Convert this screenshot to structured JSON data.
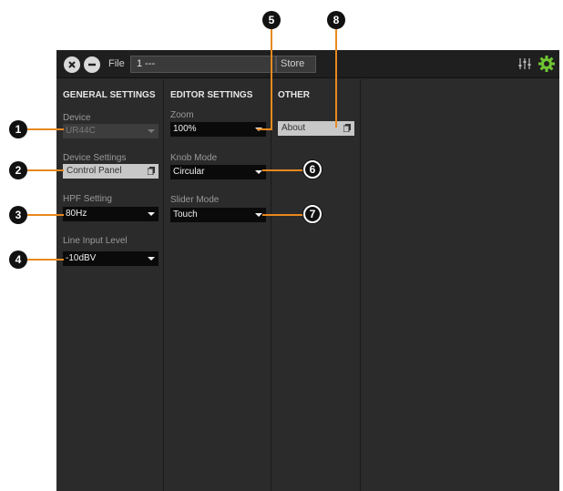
{
  "topbar": {
    "file_label": "File",
    "file_value": "1   ---",
    "store_label": "Store"
  },
  "general_settings": {
    "title": "GENERAL SETTINGS",
    "device_label": "Device",
    "device_value": "UR44C",
    "device_settings_label": "Device Settings",
    "control_panel_label": "Control Panel",
    "hpf_label": "HPF Setting",
    "hpf_value": "80Hz",
    "line_input_label": "Line Input Level",
    "line_input_value": "-10dBV"
  },
  "editor_settings": {
    "title": "EDITOR SETTINGS",
    "zoom_label": "Zoom",
    "zoom_value": "100%",
    "knob_mode_label": "Knob Mode",
    "knob_mode_value": "Circular",
    "slider_mode_label": "Slider Mode",
    "slider_mode_value": "Touch"
  },
  "other": {
    "title": "OTHER",
    "about_label": "About"
  },
  "callouts": [
    "1",
    "2",
    "3",
    "4",
    "5",
    "6",
    "7",
    "8"
  ],
  "colors": {
    "callout_line": "#e8891e",
    "background": "#2b2b2b",
    "topbar": "#1f1f1f",
    "accent_gear": "#6fc532"
  },
  "icons": [
    "close-icon",
    "minus-icon",
    "mixer-icon",
    "gear-icon",
    "copy-icon",
    "chevron-down-icon"
  ]
}
